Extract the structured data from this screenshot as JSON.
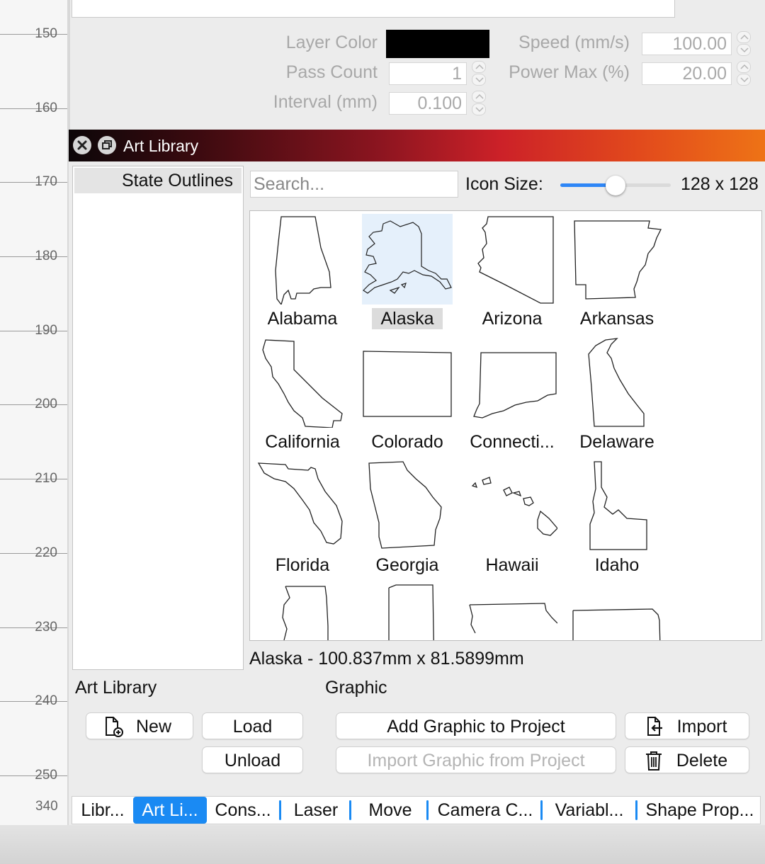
{
  "ruler": {
    "ticks": [
      "150",
      "160",
      "170",
      "180",
      "190",
      "200",
      "210",
      "220",
      "230",
      "240",
      "250"
    ],
    "bottom_label": "340"
  },
  "layer": {
    "layer_color_label": "Layer Color",
    "layer_color": "#000000",
    "pass_count_label": "Pass Count",
    "pass_count": "1",
    "interval_label": "Interval (mm)",
    "interval": "0.100",
    "speed_label": "Speed (mm/s)",
    "speed": "100.00",
    "power_label": "Power Max (%)",
    "power": "20.00"
  },
  "window": {
    "title": "Art Library"
  },
  "library": {
    "items": [
      "State Outlines"
    ],
    "selected": "State Outlines"
  },
  "search": {
    "placeholder": "Search...",
    "value": ""
  },
  "icon_size": {
    "label": "Icon Size:",
    "value": "128 x 128",
    "slider_fraction": 0.5
  },
  "graphics": [
    {
      "label": "Alabama"
    },
    {
      "label": "Alaska",
      "selected": true
    },
    {
      "label": "Arizona"
    },
    {
      "label": "Arkansas"
    },
    {
      "label": "California"
    },
    {
      "label": "Colorado"
    },
    {
      "label": "Connecti..."
    },
    {
      "label": "Delaware"
    },
    {
      "label": "Florida"
    },
    {
      "label": "Georgia"
    },
    {
      "label": "Hawaii"
    },
    {
      "label": "Idaho"
    }
  ],
  "status": "Alaska - 100.837mm x 81.5899mm",
  "sections": {
    "art_library": "Art Library",
    "graphic": "Graphic"
  },
  "buttons": {
    "new": "New",
    "load": "Load",
    "unload": "Unload",
    "add_graphic": "Add Graphic to Project",
    "import_graphic": "Import Graphic from Project",
    "import": "Import",
    "delete": "Delete"
  },
  "tabs": [
    {
      "label": "Libr..."
    },
    {
      "label": "Art Li...",
      "active": true
    },
    {
      "label": "Cons..."
    },
    {
      "label": "Laser"
    },
    {
      "label": "Move"
    },
    {
      "label": "Camera C..."
    },
    {
      "label": "Variabl..."
    },
    {
      "label": "Shape Prop..."
    }
  ],
  "colors": {
    "accent": "#1a8af3",
    "title_gradient_start": "#0c0608",
    "title_gradient_end": "#ee7316"
  }
}
